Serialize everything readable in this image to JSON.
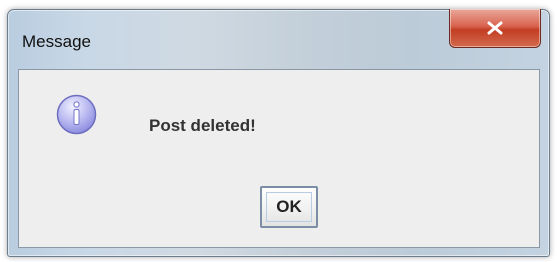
{
  "window": {
    "title": "Message"
  },
  "titlebar": {
    "close_icon": "close-x-icon"
  },
  "dialog": {
    "icon": "information-icon",
    "message": "Post deleted!",
    "ok_label": "OK"
  },
  "colors": {
    "close_button": "#c94a33",
    "info_icon": "#a9a9ee",
    "dialog_background": "#eeeeee"
  }
}
